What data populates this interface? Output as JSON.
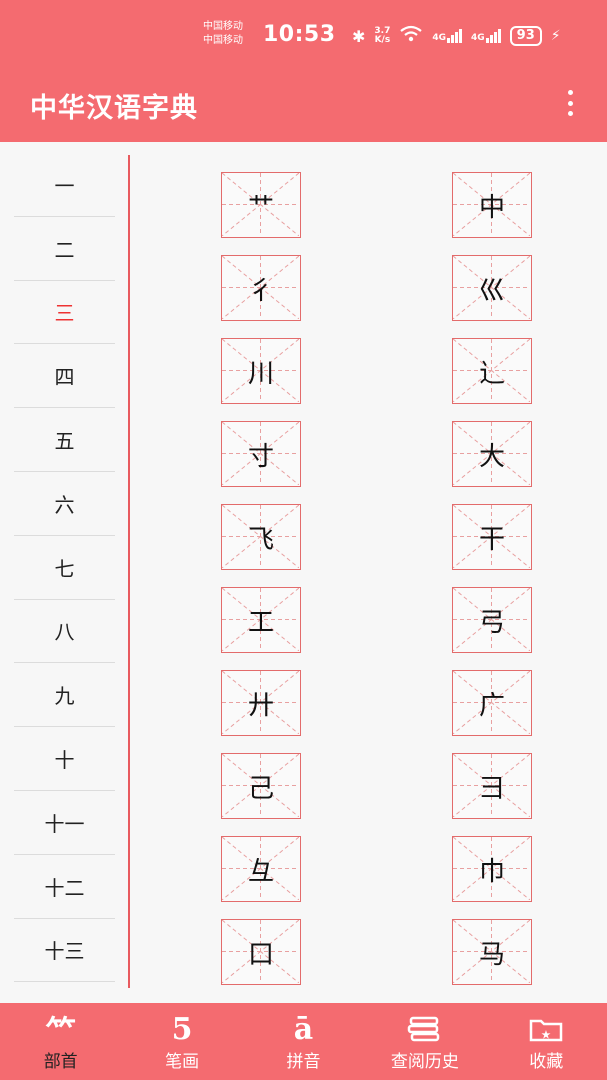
{
  "status": {
    "carrier1": "中国移动",
    "carrier2": "中国移动",
    "time": "10:53",
    "speed_top": "3.7",
    "speed_bottom": "K/s",
    "net1": "4G",
    "net2": "4G",
    "battery": "93"
  },
  "app_title": "中华汉语字典",
  "sidebar": [
    "一",
    "二",
    "三",
    "四",
    "五",
    "六",
    "七",
    "八",
    "九",
    "十",
    "十一",
    "十二",
    "十三"
  ],
  "active_index": 2,
  "characters": [
    [
      "艹",
      "中"
    ],
    [
      "彳",
      "巛"
    ],
    [
      "川",
      "辶"
    ],
    [
      "寸",
      "大"
    ],
    [
      "飞",
      "干"
    ],
    [
      "工",
      "弓"
    ],
    [
      "廾",
      "广"
    ],
    [
      "己",
      "彐"
    ],
    [
      "彑",
      "巾"
    ],
    [
      "口",
      "马"
    ]
  ],
  "nav": [
    {
      "icon": "⺮",
      "label": "部首"
    },
    {
      "icon": "5",
      "label": "笔画"
    },
    {
      "icon": "ā",
      "label": "拼音"
    },
    {
      "icon": "books-icon",
      "label": "查阅历史"
    },
    {
      "icon": "folder-star-icon",
      "label": "收藏"
    }
  ]
}
